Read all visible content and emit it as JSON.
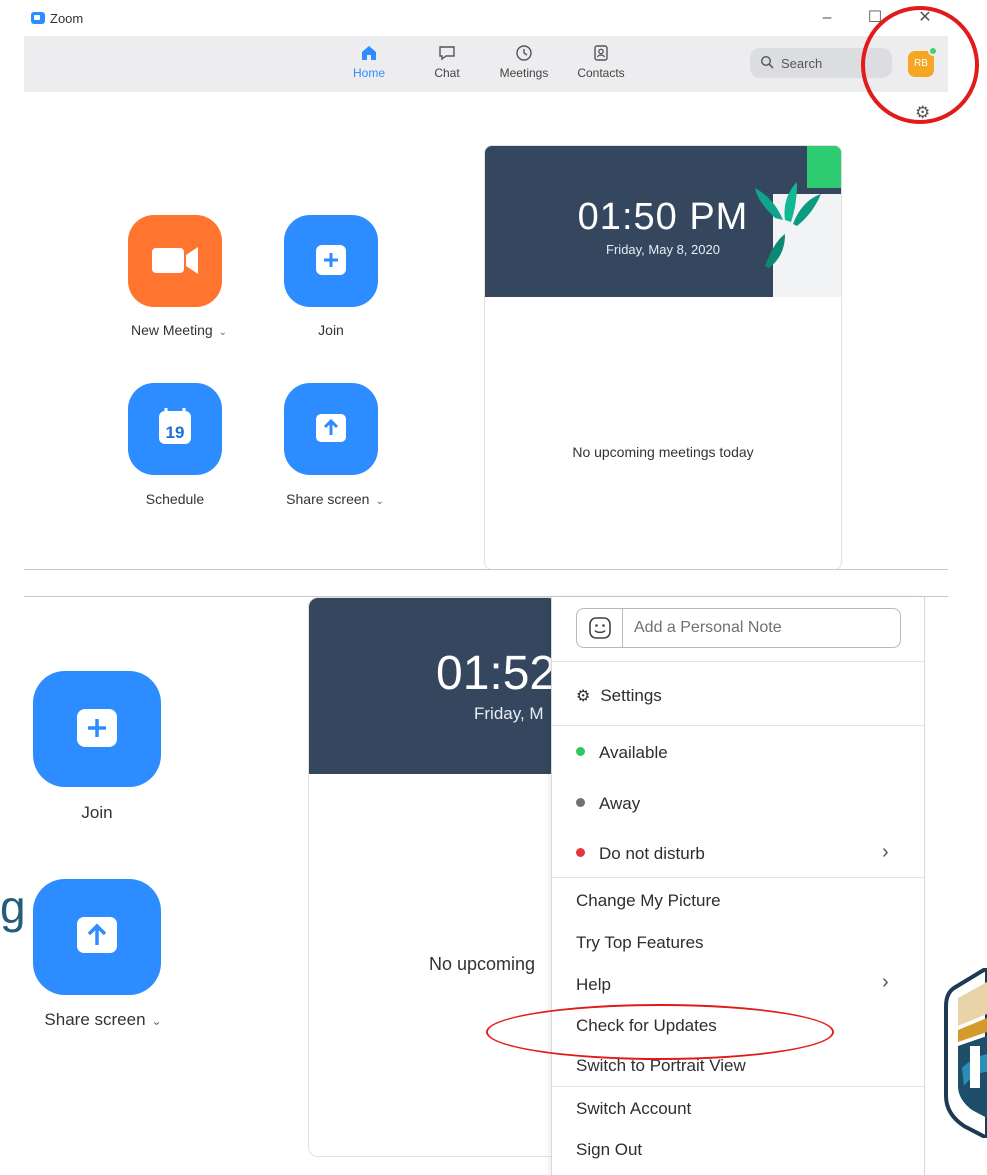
{
  "top_window": {
    "app_title": "Zoom",
    "window_controls": [
      "–",
      "☐",
      "✕"
    ],
    "nav": [
      {
        "label": "Home",
        "icon": "home-icon",
        "active": true
      },
      {
        "label": "Chat",
        "icon": "chat-icon",
        "active": false
      },
      {
        "label": "Meetings",
        "icon": "clock-icon",
        "active": false
      },
      {
        "label": "Contacts",
        "icon": "contacts-icon",
        "active": false
      }
    ],
    "search_placeholder": "Search",
    "avatar_initials": "RB",
    "status_color": "#3fd16f",
    "actions": [
      {
        "label": "New Meeting",
        "color": "#ff742e",
        "has_dropdown": true
      },
      {
        "label": "Join",
        "color": "#2d8cff",
        "has_dropdown": false
      },
      {
        "label": "Schedule",
        "color": "#2d8cff",
        "calendar_day": "19",
        "has_dropdown": false
      },
      {
        "label": "Share screen",
        "color": "#2d8cff",
        "has_dropdown": true
      }
    ],
    "clock": "01:50 PM",
    "date": "Friday, May 8, 2020",
    "no_meetings": "No upcoming meetings today"
  },
  "bottom_window": {
    "actions": [
      {
        "label": "Join",
        "has_dropdown": false
      },
      {
        "label": "Share screen",
        "has_dropdown": true
      }
    ],
    "clock_partial": "01:52",
    "date_partial": "Friday, M",
    "no_meetings_partial": "No upcoming",
    "partial_left_text": "g",
    "menu": {
      "note_placeholder": "Add a Personal Note",
      "settings": "Settings",
      "statuses": [
        {
          "label": "Available",
          "color": "#2fc85e"
        },
        {
          "label": "Away",
          "color": "#707070"
        },
        {
          "label": "Do not disturb",
          "color": "#e0383e"
        }
      ],
      "items": [
        "Change My Picture",
        "Try Top Features",
        "Help",
        "Check for Updates",
        "Switch to Portrait View"
      ],
      "account_items": [
        "Switch Account",
        "Sign Out"
      ]
    }
  },
  "accent_color": "#2d8cff",
  "highlight_color": "#e21a1a"
}
